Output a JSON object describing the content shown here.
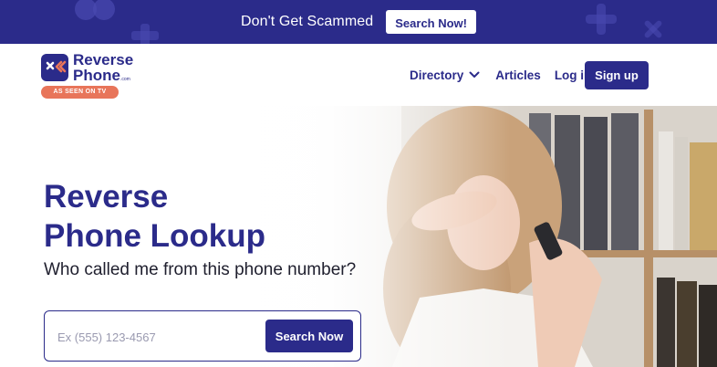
{
  "promo": {
    "text": "Don't Get Scammed",
    "button_label": "Search Now!"
  },
  "brand": {
    "name_line1": "Reverse",
    "name_line2": "Phone",
    "domain_suffix": ".com",
    "badge": "AS SEEN ON TV",
    "logo_icon": "x-arrows-icon"
  },
  "nav": {
    "items": [
      {
        "label": "Directory",
        "icon": "chevron-down-icon"
      },
      {
        "label": "Articles"
      },
      {
        "label": "Log in"
      }
    ],
    "signup_label": "Sign up"
  },
  "hero": {
    "title_line1": "Reverse",
    "title_line2": "Phone Lookup",
    "subtitle": "Who called me from this phone number?",
    "search": {
      "placeholder": "Ex (555) 123-4567",
      "value": "",
      "button_label": "Search Now"
    }
  },
  "colors": {
    "brand": "#2b2b8a",
    "accent": "#e8755a",
    "white": "#ffffff"
  }
}
